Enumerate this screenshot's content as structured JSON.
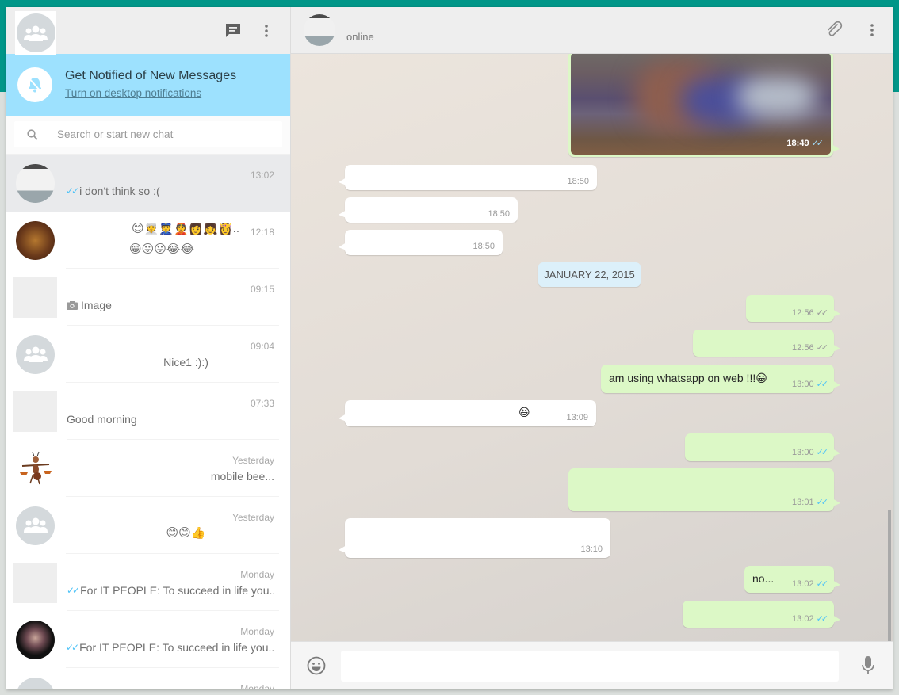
{
  "sidebar": {
    "header": {
      "new_chat_icon": "chat-icon",
      "menu_icon": "more-vertical-icon"
    },
    "notification": {
      "title": "Get Notified of New Messages",
      "link": "Turn on desktop notifications",
      "icon": "bell-off-icon"
    },
    "search": {
      "placeholder": "Search or start new chat",
      "value": ""
    },
    "chats": [
      {
        "time": "13:02",
        "preview": "i don't think so :(",
        "ticks": "read",
        "active": true
      },
      {
        "time": "12:18",
        "preview_line1": "😊👳👮👲👩👧👸..",
        "preview_line2": "😁😛😛😂😂"
      },
      {
        "time": "09:15",
        "preview": "Image",
        "preview_icon": "camera-icon"
      },
      {
        "time": "09:04",
        "preview": "Nice1 :):)"
      },
      {
        "time": "07:33",
        "preview": "Good morning"
      },
      {
        "time": "Yesterday",
        "preview": "mobile bee..."
      },
      {
        "time": "Yesterday",
        "preview": "😊😊👍"
      },
      {
        "time": "Monday",
        "preview": "For IT PEOPLE: To succeed in life you...",
        "ticks": "read"
      },
      {
        "time": "Monday",
        "preview": "For IT PEOPLE: To succeed in life you...",
        "ticks": "read"
      },
      {
        "time": "Monday",
        "preview": ""
      }
    ]
  },
  "conversation": {
    "header": {
      "status": "online",
      "attach_icon": "paperclip-icon",
      "menu_icon": "more-vertical-icon"
    },
    "date_separator": "JANUARY 22, 2015",
    "messages": [
      {
        "dir": "out",
        "type": "image",
        "time": "18:49",
        "ticks": "read"
      },
      {
        "dir": "in",
        "text": "",
        "time": "18:50"
      },
      {
        "dir": "in",
        "text": "",
        "time": "18:50"
      },
      {
        "dir": "in",
        "text": "",
        "time": "18:50"
      },
      {
        "dir": "out",
        "text": "",
        "time": "12:56",
        "ticks": "delivered"
      },
      {
        "dir": "out",
        "text": "",
        "time": "12:56",
        "ticks": "delivered"
      },
      {
        "dir": "out",
        "text": "am using whatsapp on web !!!😀",
        "time": "13:00",
        "ticks": "read"
      },
      {
        "dir": "in",
        "text": "😆",
        "time": "13:09"
      },
      {
        "dir": "out",
        "text": "",
        "time": "13:00",
        "ticks": "read"
      },
      {
        "dir": "out",
        "text": "",
        "time": "13:01",
        "ticks": "read"
      },
      {
        "dir": "in",
        "text": "",
        "time": "13:10"
      },
      {
        "dir": "out",
        "text": "no...",
        "time": "13:02",
        "ticks": "read"
      },
      {
        "dir": "out",
        "text": "",
        "time": "13:02",
        "ticks": "read"
      }
    ],
    "ticks_glyph": "✓✓"
  },
  "composer": {
    "placeholder": "",
    "value": "",
    "emoji_icon": "smiley-icon",
    "mic_icon": "microphone-icon"
  },
  "colors": {
    "brand": "#009688",
    "notification_bg": "#9de1fe",
    "outgoing_bubble": "#dcf8c6",
    "incoming_bubble": "#ffffff",
    "read_ticks": "#4fc3f7"
  }
}
